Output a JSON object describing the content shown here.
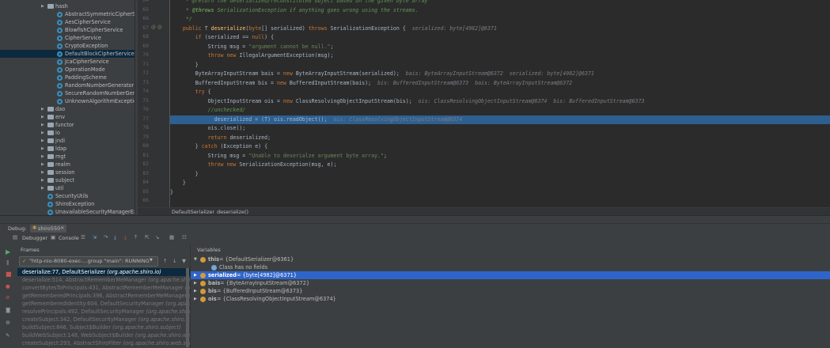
{
  "tree": {
    "items": [
      {
        "label": "hash",
        "type": "pkg",
        "indent": 60,
        "arrow": "▶"
      },
      {
        "label": "AbstractSymmetricCipherSer",
        "type": "cls",
        "indent": 72
      },
      {
        "label": "AesCipherService",
        "type": "cls",
        "indent": 72
      },
      {
        "label": "BlowfishCipherService",
        "type": "cls",
        "indent": 72
      },
      {
        "label": "CipherService",
        "type": "cls",
        "indent": 72
      },
      {
        "label": "CryptoException",
        "type": "cls",
        "indent": 72
      },
      {
        "label": "DefaultBlockCipherService",
        "type": "cls",
        "indent": 72,
        "selected": true
      },
      {
        "label": "JcaCipherService",
        "type": "cls",
        "indent": 72
      },
      {
        "label": "OperationMode",
        "type": "cls",
        "indent": 72
      },
      {
        "label": "PaddingScheme",
        "type": "cls",
        "indent": 72
      },
      {
        "label": "RandomNumberGenerator",
        "type": "cls",
        "indent": 72
      },
      {
        "label": "SecureRandomNumberGenera",
        "type": "cls",
        "indent": 72
      },
      {
        "label": "UnknownAlgorithmException",
        "type": "cls",
        "indent": 72
      },
      {
        "label": "dao",
        "type": "pkg",
        "indent": 60,
        "arrow": "▶"
      },
      {
        "label": "env",
        "type": "pkg",
        "indent": 60,
        "arrow": "▶"
      },
      {
        "label": "functor",
        "type": "pkg",
        "indent": 60,
        "arrow": "▶"
      },
      {
        "label": "io",
        "type": "pkg",
        "indent": 60,
        "arrow": "▶"
      },
      {
        "label": "jndi",
        "type": "pkg",
        "indent": 60,
        "arrow": "▶"
      },
      {
        "label": "ldap",
        "type": "pkg",
        "indent": 60,
        "arrow": "▶"
      },
      {
        "label": "mgt",
        "type": "pkg",
        "indent": 60,
        "arrow": "▶"
      },
      {
        "label": "realm",
        "type": "pkg",
        "indent": 60,
        "arrow": "▶"
      },
      {
        "label": "session",
        "type": "pkg",
        "indent": 60,
        "arrow": "▶"
      },
      {
        "label": "subject",
        "type": "pkg",
        "indent": 60,
        "arrow": "▶"
      },
      {
        "label": "util",
        "type": "pkg",
        "indent": 60,
        "arrow": "▶"
      },
      {
        "label": "SecurityUtils",
        "type": "cls",
        "indent": 60
      },
      {
        "label": "ShiroException",
        "type": "cls",
        "indent": 60
      },
      {
        "label": "UnavailableSecurityManagerExce",
        "type": "cls",
        "indent": 60
      }
    ]
  },
  "editor": {
    "lines": [
      {
        "n": "64",
        "html": "     <span class=\"cm\">* @return the deserialized/reconstituted object based on the given byte array</span>"
      },
      {
        "n": "65",
        "html": "     <span class=\"cm\">* <span class=\"tag\">@throws</span> SerializationException if anything goes wrong using the streams.</span>"
      },
      {
        "n": "66",
        "html": "     <span class=\"cm\">*/</span>"
      },
      {
        "n": "67",
        "html": "    <span class=\"kw\">public</span> T <span class=\"fn\">deserialize</span>(<span class=\"kw\">byte</span>[] serialized) <span class=\"kw\">throws</span> SerializationException {  <span class=\"dbg\">serialized: byte[4982]@6371</span>",
        "mark": "@ @"
      },
      {
        "n": "68",
        "html": "        <span class=\"kw\">if</span> (serialized == <span class=\"kw\">null</span>) {"
      },
      {
        "n": "69",
        "html": "            String msg = <span class=\"str\">\"argument cannot be null.\"</span>;"
      },
      {
        "n": "70",
        "html": "            <span class=\"kw\">throw new</span> IllegalArgumentException(msg);"
      },
      {
        "n": "71",
        "html": "        }"
      },
      {
        "n": "72",
        "html": "        ByteArrayInputStream bais = <span class=\"kw\">new</span> ByteArrayInputStream(serialized);  <span class=\"dbg\">bais: ByteArrayInputStream@6372  serialized: byte[4982]@6371</span>"
      },
      {
        "n": "73",
        "html": "        BufferedInputStream bis = <span class=\"kw\">new</span> BufferedInputStream(bais);  <span class=\"dbg\">bis: BufferedInputStream@6373  bais: ByteArrayInputStream@6372</span>"
      },
      {
        "n": "74",
        "html": "        <span class=\"kw\">try</span> {"
      },
      {
        "n": "75",
        "html": "            ObjectInputStream ois = <span class=\"kw\">new</span> ClassResolvingObjectInputStream(bis);  <span class=\"dbg\">ois: ClassResolvingObjectInputStream@6374  bis: BufferedInputStream@6373</span>"
      },
      {
        "n": "76",
        "html": "            <span class=\"cm\">//unchecked/</span>"
      },
      {
        "n": "77",
        "html": "              deserialized = (T) ois.readObject();  <span class=\"dbg\">ois: ClassResolvingObjectInputStream@6374</span>",
        "hl": true
      },
      {
        "n": "78",
        "html": "            ois.close();"
      },
      {
        "n": "79",
        "html": "            <span class=\"kw\">return</span> deserialized;"
      },
      {
        "n": "80",
        "html": "        } <span class=\"kw\">catch</span> (Exception e) {"
      },
      {
        "n": "81",
        "html": "            String msg = <span class=\"str\">\"Unable to deserialze argument byte array.\"</span>;"
      },
      {
        "n": "82",
        "html": "            <span class=\"kw\">throw new</span> SerializationException(msg, e);"
      },
      {
        "n": "83",
        "html": "        }"
      },
      {
        "n": "84",
        "html": "    }"
      },
      {
        "n": "85",
        "html": "}"
      },
      {
        "n": "86",
        "html": ""
      }
    ]
  },
  "breadcrumb": {
    "class": "DefaultSerializer",
    "method": "deserialize()"
  },
  "debug": {
    "title": "Debug:",
    "config": "shiro550",
    "tab_debugger": "Debugger",
    "tab_console": "Console",
    "frames_label": "Frames",
    "thread": "\"http-nio-8080-exec-...group \"main\": RUNNING",
    "variables_label": "Variables"
  },
  "frames": [
    {
      "text": "deserialize:77, DefaultSerializer ",
      "pkg": "(org.apache.shiro.io)",
      "selected": true
    },
    {
      "text": "deserialize:514, AbstractRememberMeManager ",
      "pkg": "(org.apache.shiro.mgt)"
    },
    {
      "text": "convertBytesToPrincipals:431, AbstractRememberMeManager ",
      "pkg": "(org.a"
    },
    {
      "text": "getRememberedPrincipals:396, AbstractRememberMeManager ",
      "pkg": "(org.a"
    },
    {
      "text": "getRememberedIdentity:604, DefaultSecurityManager ",
      "pkg": "(org.apache.sh"
    },
    {
      "text": "resolvePrincipals:492, DefaultSecurityManager ",
      "pkg": "(org.apache.shiro."
    },
    {
      "text": "createSubject:342, DefaultSecurityManager ",
      "pkg": "(org.apache.shiro.mgt)"
    },
    {
      "text": "buildSubject:846, Subject$Builder ",
      "pkg": "(org.apache.shiro.subject)"
    },
    {
      "text": "buildWebSubject:148, WebSubject$Builder ",
      "pkg": "(org.apache.shiro.web.s"
    },
    {
      "text": "createSubject:293, AbstractShiroFilter ",
      "pkg": "(org.apache.shiro.web.servlet)"
    }
  ],
  "variables": [
    {
      "name": "this",
      "value": " = {DefaultSerializer@6361}",
      "arrow": "▼",
      "indent": 4
    },
    {
      "name": "",
      "value": "Class has no fields",
      "indent": 18,
      "info": true
    },
    {
      "name": "serialized",
      "value": " = {byte[4982]@6371}",
      "arrow": "▶",
      "indent": 4,
      "selected": true
    },
    {
      "name": "bais",
      "value": " = {ByteArrayInputStream@6372}",
      "arrow": "▶",
      "indent": 4
    },
    {
      "name": "bis",
      "value": " = {BufferedInputStream@6373}",
      "arrow": "▶",
      "indent": 4
    },
    {
      "name": "ois",
      "value": " = {ClassResolvingObjectInputStream@6374}",
      "arrow": "▶",
      "indent": 4
    }
  ]
}
